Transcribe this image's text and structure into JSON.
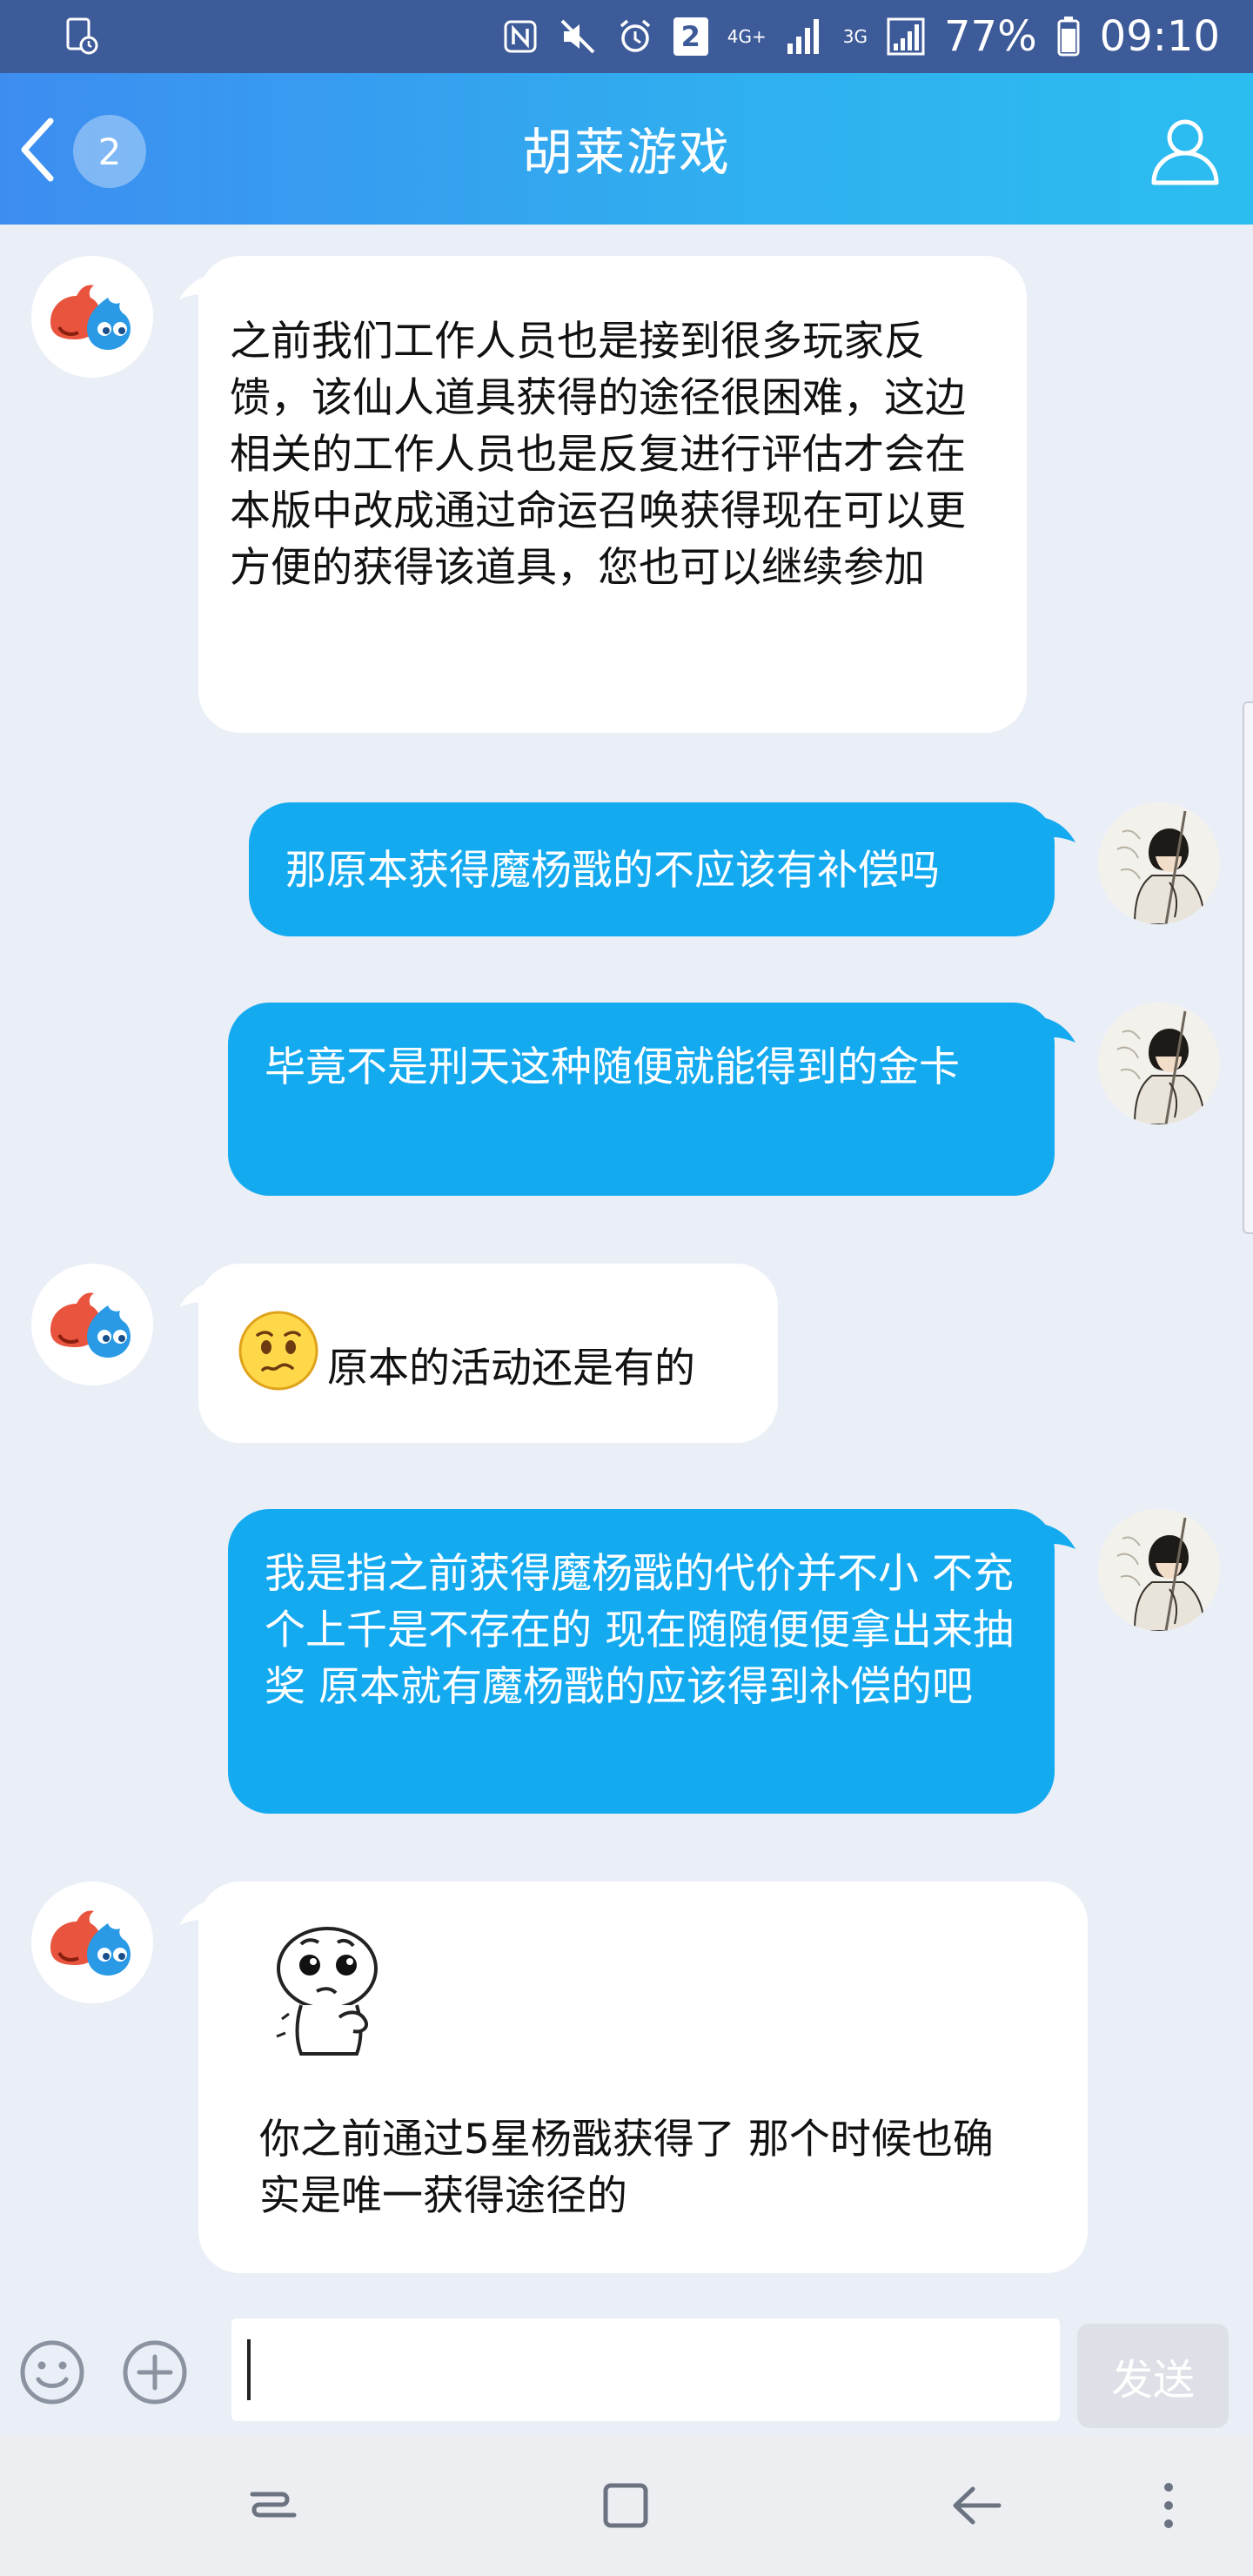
{
  "status_bar": {
    "network_label": "4G+",
    "network_label_2": "3G",
    "notification_count": "2",
    "battery": "77%",
    "time": "09:10"
  },
  "header": {
    "back_count": "2",
    "title": "胡莱游戏"
  },
  "messages": [
    {
      "side": "in",
      "text": "之前我们工作人员也是接到很多玩家反馈，该仙人道具获得的途径很困难，这边相关的工作人员也是反复进行评估才会在本版中改成通过命运召唤获得现在可以更方便的获得该道具，您也可以继续参加"
    },
    {
      "side": "out",
      "text": "那原本获得魔杨戬的不应该有补偿吗"
    },
    {
      "side": "out",
      "text": "毕竟不是刑天这种随便就能得到的金卡"
    },
    {
      "side": "in",
      "text": "原本的活动还是有的",
      "emoji": "confused-face-emoji"
    },
    {
      "side": "out",
      "text": "我是指之前获得魔杨戬的代价并不小 不充个上千是不存在的 现在随随便便拿出来抽奖 原本就有魔杨戬的应该得到补偿的吧"
    },
    {
      "side": "in",
      "text": "你之前通过5星杨戬获得了  那个时候也确实是唯一获得途径的",
      "sticker": "thinking-sticker"
    }
  ],
  "input": {
    "value": "",
    "send_label": "发送"
  },
  "colors": {
    "status_bar_bg": "#3d5a99",
    "header_gradient_start": "#3d8df0",
    "header_gradient_end": "#2cbdf0",
    "outgoing_bubble": "#14aaf0",
    "incoming_bubble": "#ffffff",
    "chat_bg": "#eaeef6"
  }
}
